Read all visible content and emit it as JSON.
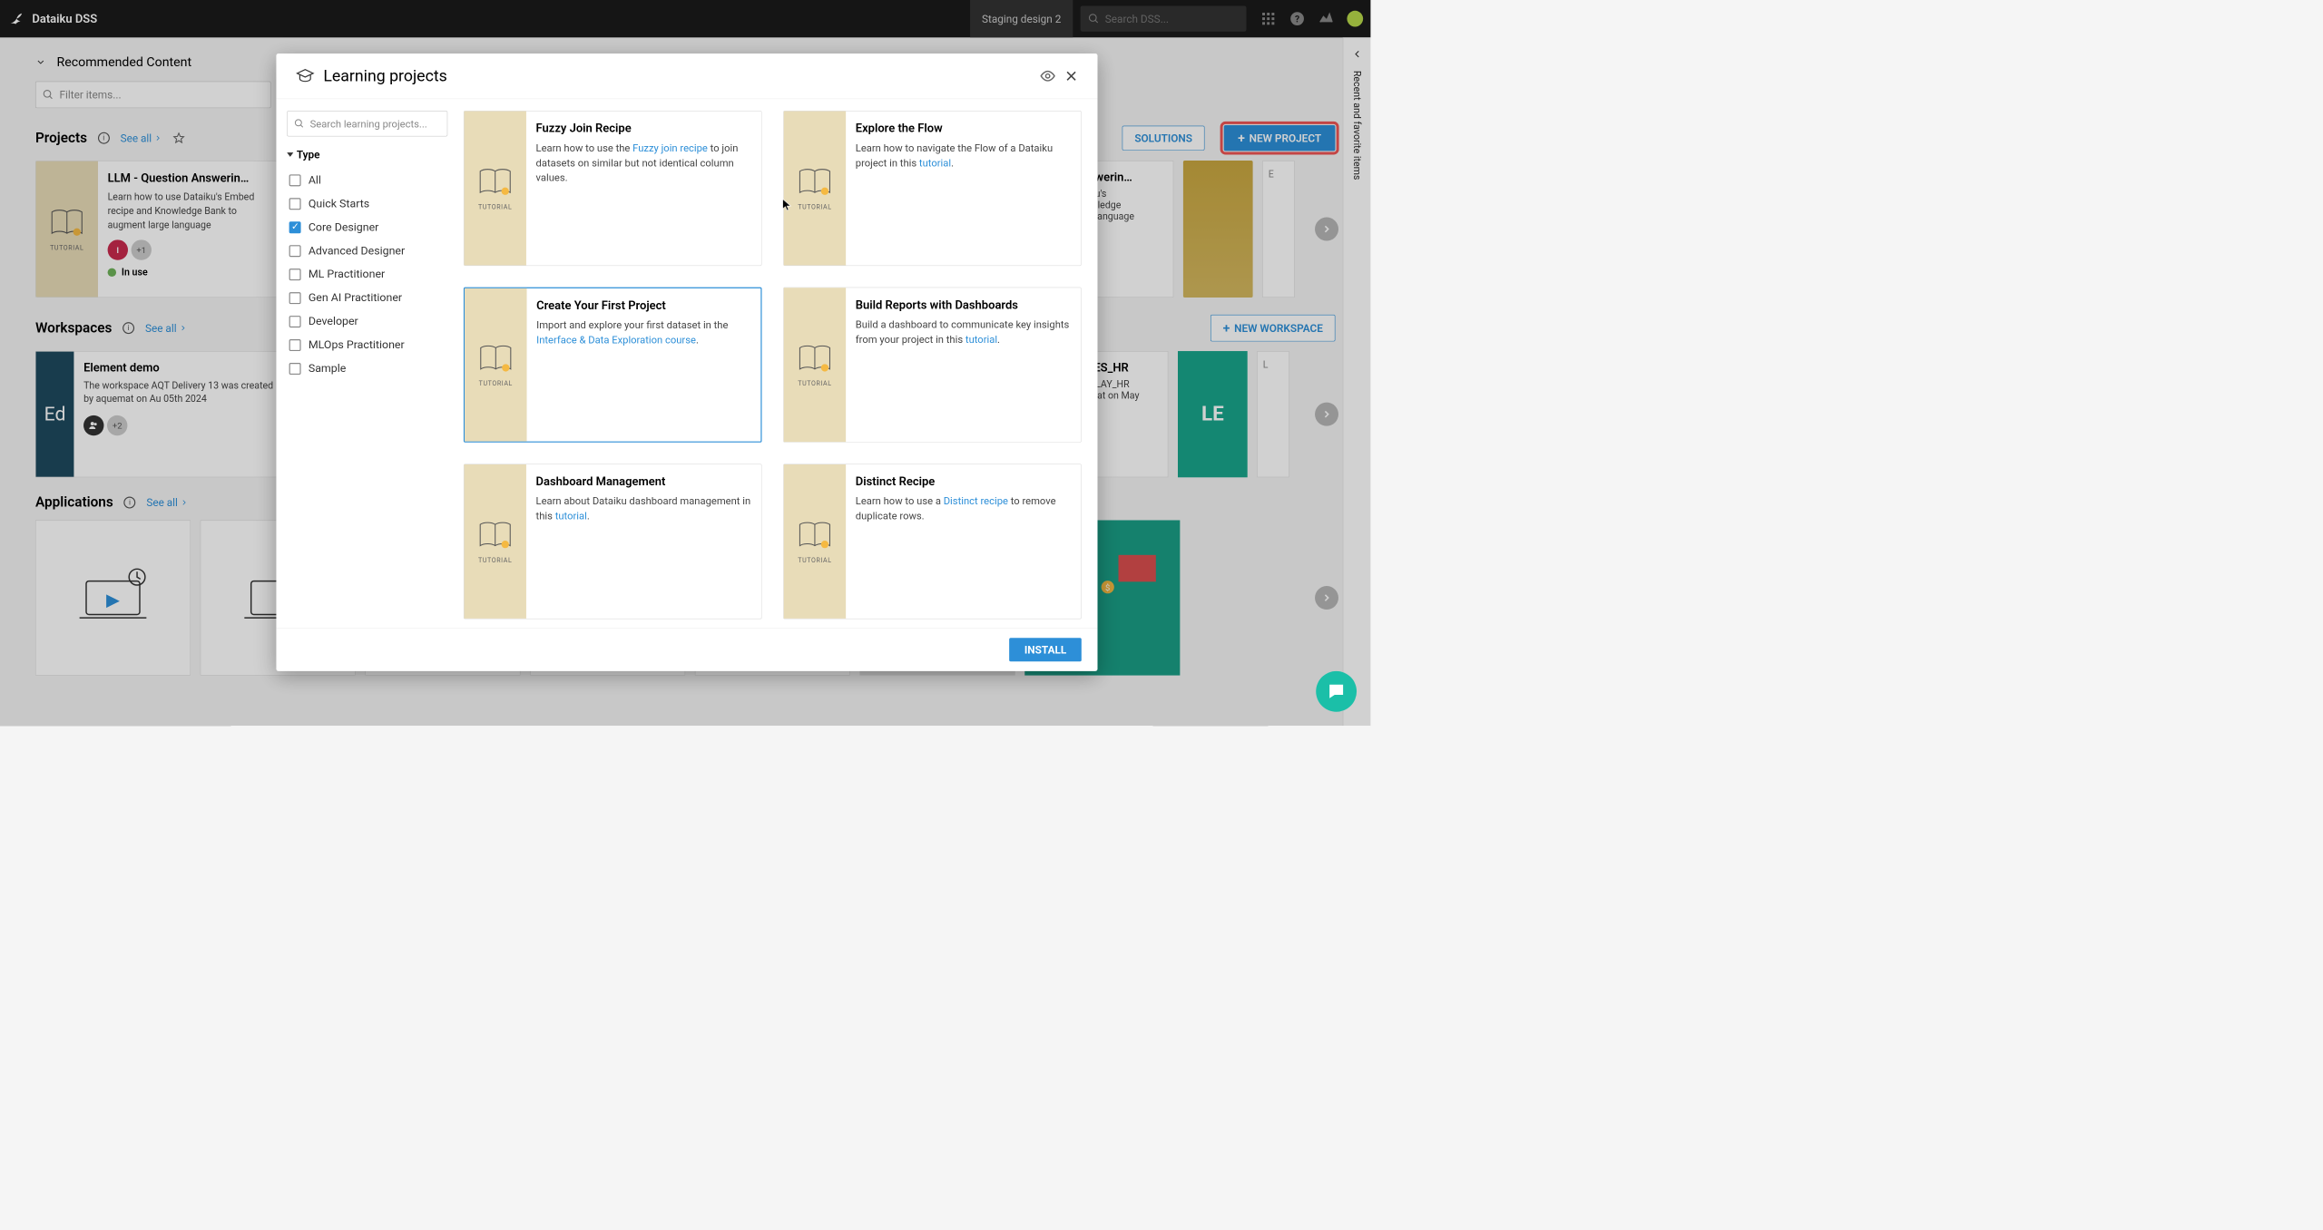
{
  "brand": "Dataiku DSS",
  "stage": "Staging design 2",
  "search_placeholder": "Search DSS...",
  "recommended": "Recommended Content",
  "filter_placeholder": "Filter items...",
  "sections": {
    "projects": {
      "title": "Projects",
      "see_all": "See all"
    },
    "workspaces": {
      "title": "Workspaces",
      "see_all": "See all"
    },
    "applications": {
      "title": "Applications",
      "see_all": "See all"
    }
  },
  "buttons": {
    "solutions": "SOLUTIONS",
    "new_project": "NEW PROJECT",
    "new_workspace": "NEW WORKSPACE",
    "install": "INSTALL"
  },
  "proj_card": {
    "title": "LLM - Question Answerin…",
    "desc": "Learn how to use Dataiku's Embed recipe and Knowledge Bank to augment large language",
    "badge": "I",
    "more": "+1",
    "inuse": "In use"
  },
  "proj_peek": {
    "title": "ion Answerin…",
    "l1": "se Dataiku's",
    "l2": "and Knowledge",
    "l3": "ent large language"
  },
  "ws_card": {
    "thumb": "Ed",
    "title": "Element demo",
    "desc": "The workspace AQT Delivery 13 was created by aquemat on Au 05th 2024",
    "more": "+2"
  },
  "ws_peek1": {
    "title": "_STORIES_HR",
    "l1": "e LETS_PLAY_HR",
    "l2": "by aquemat on May"
  },
  "ws_peek2": "LE",
  "rail": "Recent and favorite items",
  "tutorial_label": "TUTORIAL",
  "modal": {
    "title": "Learning projects",
    "search_placeholder": "Search learning projects...",
    "type_label": "Type",
    "filters": [
      "All",
      "Quick Starts",
      "Core Designer",
      "Advanced Designer",
      "ML Practitioner",
      "Gen AI Practitioner",
      "Developer",
      "MLOps Practitioner",
      "Sample"
    ],
    "checked_index": 2
  },
  "lp": [
    {
      "title": "Fuzzy Join Recipe",
      "d1": "Learn how to use the ",
      "link1": "Fuzzy join recipe",
      "d2": " to join datasets on similar but not identical column values."
    },
    {
      "title": "Explore the Flow",
      "d1": "Learn how to navigate the Flow of a Dataiku project in this ",
      "link1": "tutorial",
      "d2": "."
    },
    {
      "title": "Create Your First Project",
      "d1": "Import and explore your first dataset in the ",
      "link1": "Interface & Data Exploration course",
      "d2": "."
    },
    {
      "title": "Build Reports with Dashboards",
      "d1": "Build a dashboard to communicate key insights from your project in this ",
      "link1": "tutorial",
      "d2": "."
    },
    {
      "title": "Dashboard Management",
      "d1": "Learn about Dataiku dashboard management in this ",
      "link1": "tutorial",
      "d2": "."
    },
    {
      "title": "Distinct Recipe",
      "d1": "Learn how to use a ",
      "link1": "Distinct recipe",
      "d2": " to remove duplicate rows."
    }
  ]
}
